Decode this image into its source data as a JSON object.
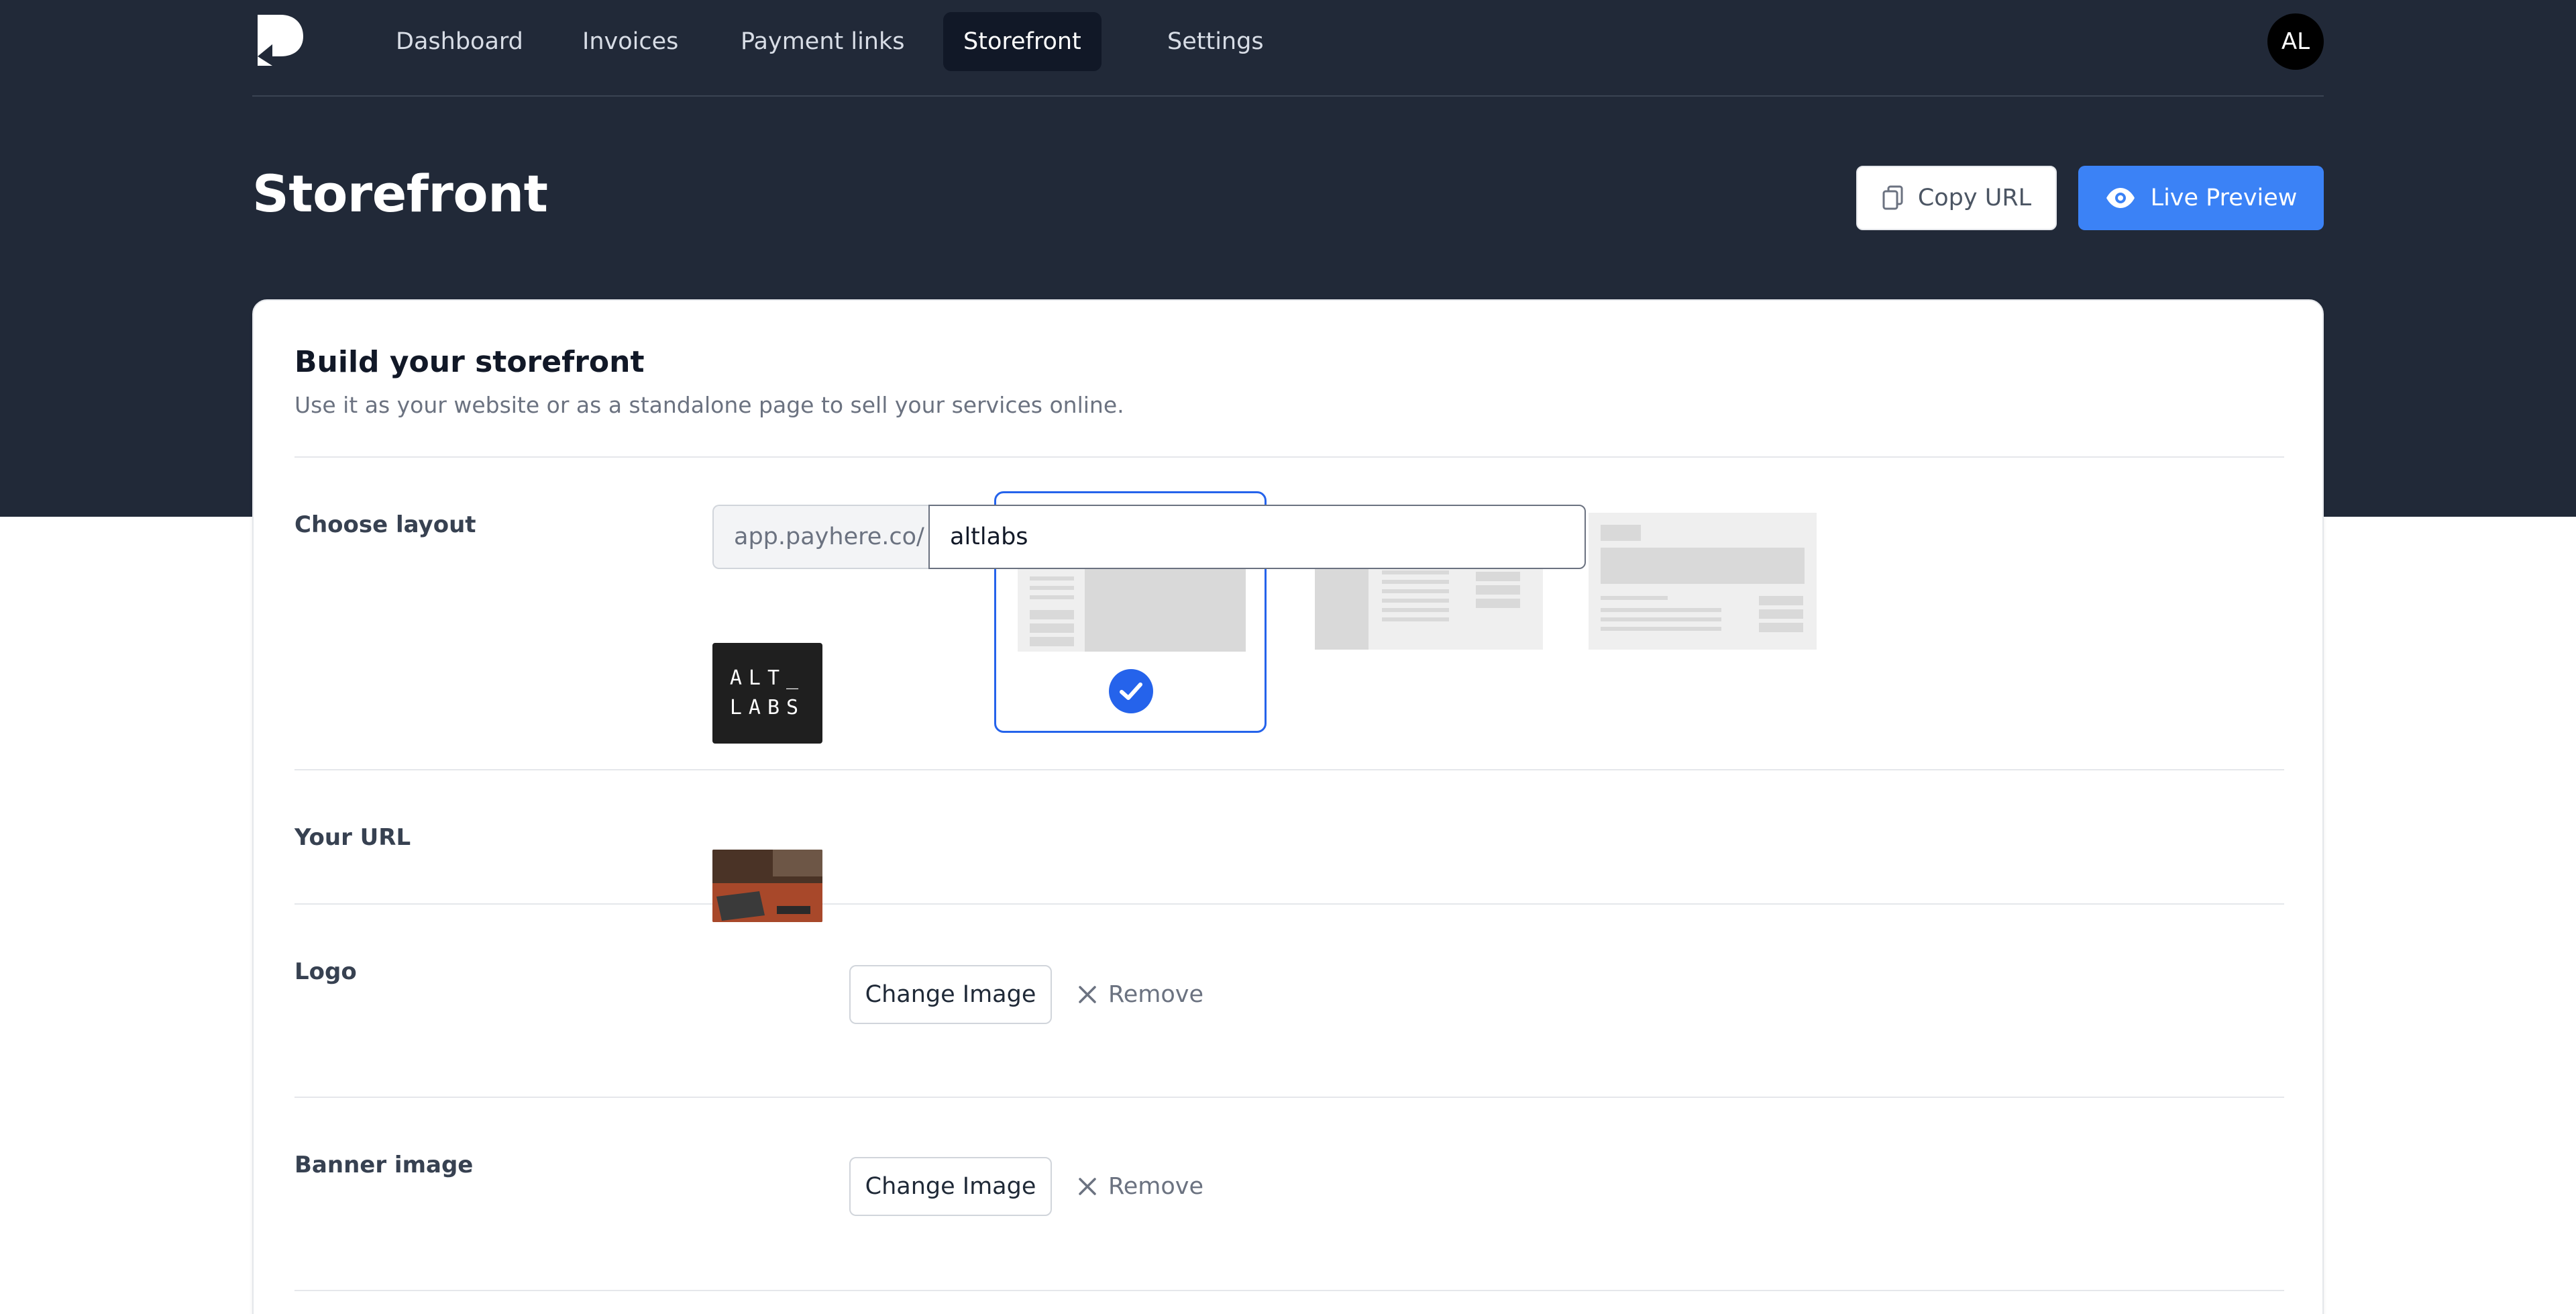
{
  "nav": {
    "items": [
      {
        "label": "Dashboard"
      },
      {
        "label": "Invoices"
      },
      {
        "label": "Payment links"
      },
      {
        "label": "Storefront",
        "active": true
      },
      {
        "label": "Settings"
      }
    ],
    "avatar_initials": "AL"
  },
  "header": {
    "title": "Storefront",
    "copy_url_label": "Copy URL",
    "live_preview_label": "Live Preview"
  },
  "card": {
    "title": "Build your storefront",
    "subtitle": "Use it as your website or as a standalone page to sell your services online."
  },
  "layout": {
    "label": "Choose layout",
    "selected_index": 0
  },
  "url": {
    "label": "Your URL",
    "prefix": "app.payhere.co/",
    "value": "altlabs"
  },
  "logo": {
    "label": "Logo",
    "image_text_line1": "ALT_",
    "image_text_line2": "LABS",
    "change_label": "Change Image",
    "remove_label": "Remove"
  },
  "banner": {
    "label": "Banner image",
    "change_label": "Change Image",
    "remove_label": "Remove"
  },
  "colors": {
    "header_bg": "#212938",
    "accent": "#3b82f6",
    "selected_border": "#2563eb"
  }
}
